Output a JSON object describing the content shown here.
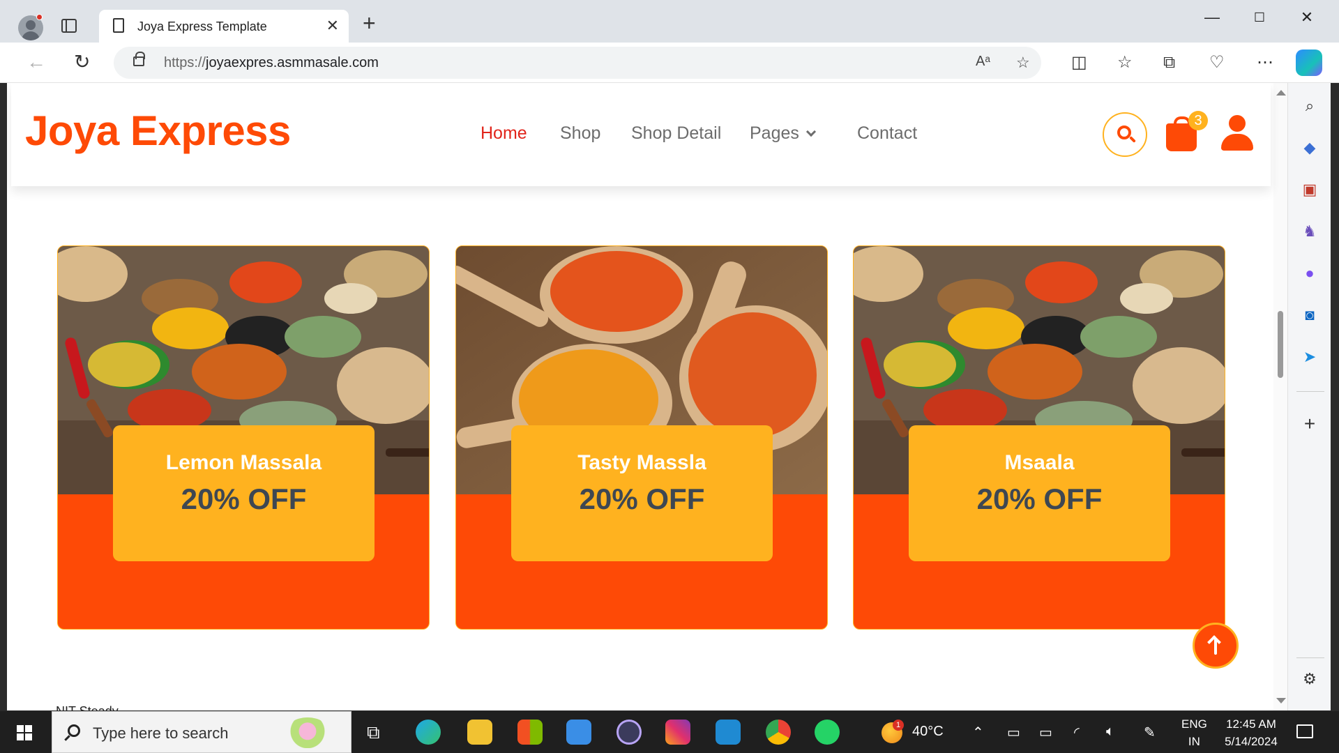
{
  "browser": {
    "tab_title": "Joya Express Template",
    "url_protocol": "https://",
    "url_host": "joyaexpres.asmmasale.com"
  },
  "site": {
    "logo": "Joya Express",
    "nav": [
      {
        "label": "Home",
        "active": true
      },
      {
        "label": "Shop",
        "active": false
      },
      {
        "label": "Shop Detail",
        "active": false
      },
      {
        "label": "Pages",
        "active": false
      },
      {
        "label": "Contact",
        "active": false
      }
    ],
    "cart_count": "3",
    "colors": {
      "primary": "#fe4a06",
      "secondary": "#ffb21f",
      "text_dark": "#3e4752"
    }
  },
  "offers": [
    {
      "name": "Lemon Massala",
      "discount": "20% OFF",
      "image": "spice-bowls"
    },
    {
      "name": "Tasty Massla",
      "discount": "20% OFF",
      "image": "spice-spoons"
    },
    {
      "name": "Msaala",
      "discount": "20% OFF",
      "image": "spice-bowls"
    }
  ],
  "peek_text": "NIT Steady",
  "taskbar": {
    "search_placeholder": "Type here to search",
    "weather_badge": "1",
    "temperature": "40°C",
    "language_line1": "ENG",
    "language_line2": "IN",
    "time": "12:45 AM",
    "date": "5/14/2024"
  }
}
